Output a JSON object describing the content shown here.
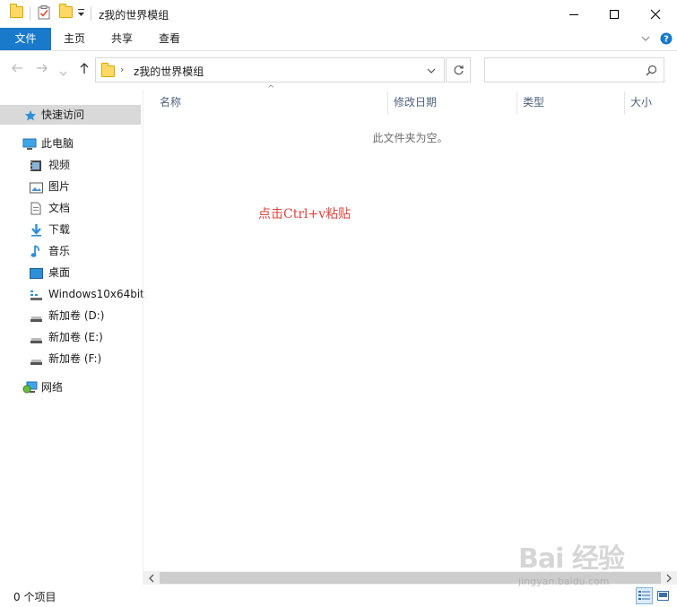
{
  "window": {
    "title": "z我的世界模组"
  },
  "ribbon": {
    "tabs": [
      {
        "label": "文件",
        "active": true
      },
      {
        "label": "主页"
      },
      {
        "label": "共享"
      },
      {
        "label": "查看"
      }
    ]
  },
  "address": {
    "path_segment": "z我的世界模组",
    "search_placeholder": ""
  },
  "sidebar": {
    "quick_access": "快速访问",
    "this_pc": "此电脑",
    "pc_items": [
      "视频",
      "图片",
      "文档",
      "下载",
      "音乐",
      "桌面",
      "Windows10x64bit",
      "新加卷 (D:)",
      "新加卷 (E:)",
      "新加卷 (F:)"
    ],
    "network": "网络"
  },
  "content": {
    "columns": [
      "名称",
      "修改日期",
      "类型",
      "大小"
    ],
    "empty_message": "此文件夹为空。",
    "annotation": "点击Ctrl+v粘贴"
  },
  "status": {
    "item_count": "0 个项目"
  },
  "watermark": {
    "logo": "Bai  经验",
    "url": "jingyan.baidu.com"
  },
  "colors": {
    "accent": "#1979ca",
    "annotation": "#e0423c",
    "column_header": "#4c607a",
    "selection": "#d9d9d9"
  }
}
